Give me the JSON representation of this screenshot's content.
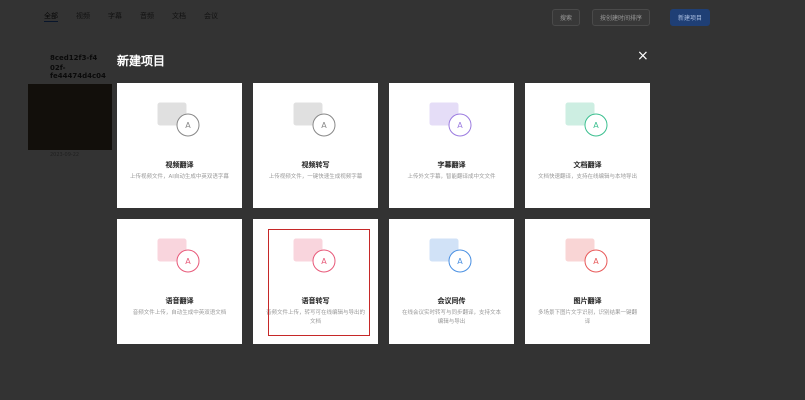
{
  "nav": {
    "tabs": [
      "全部",
      "视频",
      "字幕",
      "音频",
      "文档",
      "会议"
    ],
    "search": "搜索",
    "sort": "按创建时间排序",
    "new_project": "新建项目"
  },
  "project": {
    "name_line1": "8ced12f3-f4",
    "name_line2": "02f-fe44474d4c04",
    "date": "2023-09-22"
  },
  "modal": {
    "title": "新建项目",
    "close": "×",
    "cards": [
      {
        "title": "视频翻译",
        "desc": "上传视频文件，AI自动生成中英双语字幕",
        "icon": "video-translate-icon",
        "color": "#888888"
      },
      {
        "title": "视频转写",
        "desc": "上传视频文件，一键快速生成视频字幕",
        "icon": "video-transcribe-icon",
        "color": "#888888"
      },
      {
        "title": "字幕翻译",
        "desc": "上传外文字幕，智能翻译成中文文件",
        "icon": "subtitle-translate-icon",
        "color": "#9b7be0"
      },
      {
        "title": "文档翻译",
        "desc": "文档快速翻译，支持在线编辑与本地导出",
        "icon": "document-translate-icon",
        "color": "#3bbf8f"
      },
      {
        "title": "语音翻译",
        "desc": "音频文件上传，自动生成中英双语文档",
        "icon": "audio-translate-icon",
        "color": "#e85a7a"
      },
      {
        "title": "语音转写",
        "desc": "音频文件上传，转写可在线编辑与导出的文档",
        "icon": "audio-transcribe-icon",
        "color": "#e85a7a"
      },
      {
        "title": "会议同传",
        "desc": "在线会议实时转写与同步翻译，支持文本编辑与导出",
        "icon": "meeting-interpret-icon",
        "color": "#4a90e2"
      },
      {
        "title": "图片翻译",
        "desc": "多场景下图片文字识别，识别结果一键翻译",
        "icon": "image-translate-icon",
        "color": "#e85a5a"
      }
    ]
  }
}
